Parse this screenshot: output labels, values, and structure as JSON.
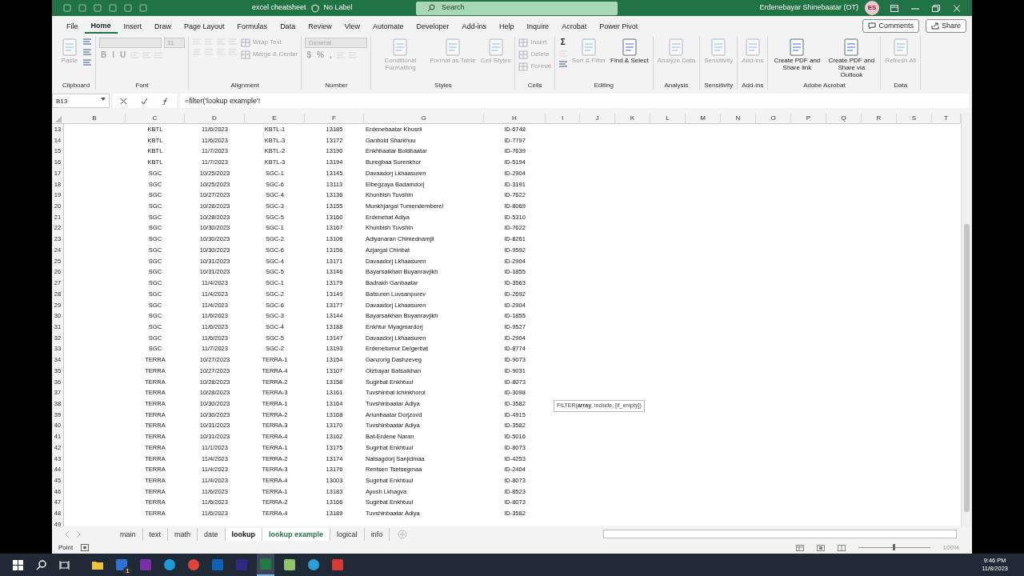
{
  "title_bar": {
    "file_name": "excel cheatsheet",
    "label": "No Label",
    "search_placeholder": "Search",
    "user": "Erdenebayar Shinebaatar (OT)",
    "avatar": "ES"
  },
  "menu_tabs": [
    {
      "label": "File",
      "selected": false
    },
    {
      "label": "Home",
      "selected": true
    },
    {
      "label": "Insert",
      "selected": false
    },
    {
      "label": "Draw",
      "selected": false
    },
    {
      "label": "Page Layout",
      "selected": false
    },
    {
      "label": "Formulas",
      "selected": false
    },
    {
      "label": "Data",
      "selected": false
    },
    {
      "label": "Review",
      "selected": false
    },
    {
      "label": "View",
      "selected": false
    },
    {
      "label": "Automate",
      "selected": false
    },
    {
      "label": "Developer",
      "selected": false
    },
    {
      "label": "Add-ins",
      "selected": false
    },
    {
      "label": "Help",
      "selected": false
    },
    {
      "label": "Inquire",
      "selected": false
    },
    {
      "label": "Acrobat",
      "selected": false
    },
    {
      "label": "Power Pivot",
      "selected": false
    }
  ],
  "comments_button": "Comments",
  "share_button": "Share",
  "ribbon_groups": [
    {
      "label": "Clipboard",
      "items": [
        {
          "kind": "large",
          "label": "Paste",
          "disabled": true
        },
        {
          "kind": "stack",
          "items": [
            {
              "kind": "icon",
              "disabled": false
            },
            {
              "kind": "icon",
              "disabled": false
            },
            {
              "kind": "icon",
              "disabled": false
            }
          ]
        }
      ]
    },
    {
      "label": "Font",
      "items": [
        {
          "kind": "stack",
          "items": [
            {
              "kind": "row",
              "items": [
                {
                  "kind": "field",
                  "disabled": true
                },
                {
                  "kind": "small_field",
                  "value": "11",
                  "disabled": true
                }
              ]
            },
            {
              "kind": "row",
              "items": [
                {
                  "kind": "glyph",
                  "text": "B",
                  "disabled": true
                },
                {
                  "kind": "glyph",
                  "text": "I",
                  "disabled": true
                },
                {
                  "kind": "glyph",
                  "text": "U",
                  "disabled": true
                },
                {
                  "kind": "icon",
                  "disabled": true
                },
                {
                  "kind": "icon",
                  "disabled": true
                },
                {
                  "kind": "icon",
                  "disabled": true
                }
              ]
            }
          ]
        }
      ]
    },
    {
      "label": "Alignment",
      "items": [
        {
          "kind": "stack",
          "items": [
            {
              "kind": "row",
              "items": [
                {
                  "kind": "icon",
                  "disabled": true
                },
                {
                  "kind": "icon",
                  "disabled": true
                },
                {
                  "kind": "icon",
                  "disabled": true
                },
                {
                  "kind": "icon",
                  "disabled": true
                }
              ]
            },
            {
              "kind": "row",
              "items": [
                {
                  "kind": "icon",
                  "disabled": true
                },
                {
                  "kind": "icon",
                  "disabled": true
                },
                {
                  "kind": "icon",
                  "disabled": true
                },
                {
                  "kind": "icon",
                  "disabled": true
                }
              ]
            }
          ]
        },
        {
          "kind": "stack",
          "items": [
            {
              "kind": "small",
              "label": "Wrap Text",
              "disabled": true
            },
            {
              "kind": "small",
              "label": "Merge & Center",
              "disabled": true
            }
          ]
        }
      ]
    },
    {
      "label": "Number",
      "items": [
        {
          "kind": "stack",
          "items": [
            {
              "kind": "field",
              "value": "General",
              "disabled": true
            },
            {
              "kind": "row",
              "items": [
                {
                  "kind": "glyph",
                  "text": "$",
                  "disabled": true
                },
                {
                  "kind": "glyph",
                  "text": "%",
                  "disabled": true
                },
                {
                  "kind": "glyph",
                  "text": ",",
                  "disabled": true
                },
                {
                  "kind": "icon",
                  "disabled": true
                },
                {
                  "kind": "icon",
                  "disabled": true
                }
              ]
            }
          ]
        }
      ]
    },
    {
      "label": "Styles",
      "items": [
        {
          "kind": "large",
          "label": "Conditional Formatting",
          "disabled": true
        },
        {
          "kind": "large",
          "label": "Format as Table",
          "disabled": true
        },
        {
          "kind": "large",
          "label": "Cell Styles",
          "disabled": true
        }
      ]
    },
    {
      "label": "Cells",
      "items": [
        {
          "kind": "stack",
          "items": [
            {
              "kind": "small",
              "label": "Insert",
              "disabled": true
            },
            {
              "kind": "small",
              "label": "Delete",
              "disabled": true
            },
            {
              "kind": "small",
              "label": "Format",
              "disabled": true
            }
          ]
        }
      ]
    },
    {
      "label": "Editing",
      "items": [
        {
          "kind": "stack",
          "items": [
            {
              "kind": "glyph",
              "text": "Σ",
              "disabled": false
            },
            {
              "kind": "icon",
              "disabled": true
            },
            {
              "kind": "icon",
              "disabled": false
            }
          ]
        },
        {
          "kind": "large",
          "label": "Sort & Filter",
          "disabled": true
        },
        {
          "kind": "large",
          "label": "Find & Select",
          "disabled": false
        }
      ]
    },
    {
      "label": "Analysis",
      "items": [
        {
          "kind": "large",
          "label": "Analyze Data",
          "disabled": true
        }
      ]
    },
    {
      "label": "Sensitivity",
      "items": [
        {
          "kind": "large",
          "label": "Sensitivity",
          "disabled": true
        }
      ]
    },
    {
      "label": "Add-ins",
      "items": [
        {
          "kind": "large",
          "label": "Add-ins",
          "disabled": true
        }
      ]
    },
    {
      "label": "Adobe Acrobat",
      "items": [
        {
          "kind": "large",
          "label": "Create PDF and Share link",
          "disabled": false
        },
        {
          "kind": "large",
          "label": "Create PDF and Share via Outlook",
          "disabled": false
        }
      ]
    },
    {
      "label": "Data",
      "items": [
        {
          "kind": "large",
          "label": "Refresh All",
          "disabled": true
        }
      ]
    }
  ],
  "formula_bar": {
    "name_box": "B13",
    "formula": "=filter('lookup example'!"
  },
  "columns": [
    "B",
    "C",
    "D",
    "E",
    "F",
    "G",
    "H",
    "I",
    "J",
    "K",
    "L",
    "M",
    "N",
    "O",
    "P",
    "Q",
    "R",
    "S",
    "T"
  ],
  "rows": [
    {
      "number": "13",
      "values": [
        "KBTL",
        "11/6/2023",
        "KBTL-1",
        "13185",
        "Erdenebaatar Khusrii",
        "ID-6748"
      ]
    },
    {
      "number": "14",
      "values": [
        "KBTL",
        "11/6/2023",
        "KBTL-3",
        "13172",
        "Ganbold Sharkhuu",
        "ID-7797"
      ]
    },
    {
      "number": "15",
      "values": [
        "KBTL",
        "11/7/2023",
        "KBTL-2",
        "13190",
        "Enkhbaatar Boldbaatar",
        "ID-7639"
      ]
    },
    {
      "number": "16",
      "values": [
        "KBTL",
        "11/7/2023",
        "KBTL-3",
        "13194",
        "Buregbaa Surenkhor",
        "ID-5194"
      ]
    },
    {
      "number": "17",
      "values": [
        "SGC",
        "10/25/2023",
        "SGC-1",
        "13145",
        "Davaadorj Lkhaasuren",
        "ID-2904"
      ]
    },
    {
      "number": "18",
      "values": [
        "SGC",
        "10/25/2023",
        "SGC-6",
        "13113",
        "Elbegzaya Badamdorj",
        "ID-3191"
      ]
    },
    {
      "number": "19",
      "values": [
        "SGC",
        "10/27/2023",
        "SGC-4",
        "13136",
        "Khunbish Tuvshin",
        "ID-7622"
      ]
    },
    {
      "number": "20",
      "values": [
        "SGC",
        "10/28/2023",
        "SGC-3",
        "13155",
        "Munkhjargal Tumendemberel",
        "ID-8069"
      ]
    },
    {
      "number": "21",
      "values": [
        "SGC",
        "10/28/2023",
        "SGC-5",
        "13160",
        "Erdenebat Adiya",
        "ID-5310"
      ]
    },
    {
      "number": "22",
      "values": [
        "SGC",
        "10/30/2023",
        "SGC-1",
        "13167",
        "Khunbish Tuvshin",
        "ID-7622"
      ]
    },
    {
      "number": "23",
      "values": [
        "SGC",
        "10/30/2023",
        "SGC-2",
        "13106",
        "Adiyanaran Chimednamjil",
        "ID-8261"
      ]
    },
    {
      "number": "24",
      "values": [
        "SGC",
        "10/30/2023",
        "SGC-6",
        "13156",
        "Azjargal Chinbat",
        "ID-9592"
      ]
    },
    {
      "number": "25",
      "values": [
        "SGC",
        "10/31/2023",
        "SGC-4",
        "13171",
        "Davaadorj Lkhaasuren",
        "ID-2904"
      ]
    },
    {
      "number": "26",
      "values": [
        "SGC",
        "10/31/2023",
        "SGC-5",
        "13146",
        "Bayarsaikhan Buyanravjikh",
        "ID-1855"
      ]
    },
    {
      "number": "27",
      "values": [
        "SGC",
        "11/4/2023",
        "SGC-1",
        "13179",
        "Badrakh Ganbaatar",
        "ID-3563"
      ]
    },
    {
      "number": "28",
      "values": [
        "SGC",
        "11/4/2023",
        "SGC-2",
        "13149",
        "Batsuren Luvsanpurev",
        "ID-2692"
      ]
    },
    {
      "number": "29",
      "values": [
        "SGC",
        "11/4/2023",
        "SGC-6",
        "13177",
        "Davaadorj Lkhaasuren",
        "ID-2904"
      ]
    },
    {
      "number": "30",
      "values": [
        "SGC",
        "11/6/2023",
        "SGC-3",
        "13144",
        "Bayarsaikhan Buyanravjikh",
        "ID-1855"
      ]
    },
    {
      "number": "31",
      "values": [
        "SGC",
        "11/6/2023",
        "SGC-4",
        "13188",
        "Enkhtur Myagmardorj",
        "ID-9527"
      ]
    },
    {
      "number": "32",
      "values": [
        "SGC",
        "11/6/2023",
        "SGC-5",
        "13147",
        "Davaadorj Lkhaasuren",
        "ID-2904"
      ]
    },
    {
      "number": "33",
      "values": [
        "SGC",
        "11/7/2023",
        "SGC-2",
        "13193",
        "Erdenetumur Delgerbat",
        "ID-8774"
      ]
    },
    {
      "number": "34",
      "values": [
        "TERRA",
        "10/27/2023",
        "TERRA-1",
        "13154",
        "Ganzorig Dashzeveg",
        "ID-9073"
      ]
    },
    {
      "number": "35",
      "values": [
        "TERRA",
        "10/27/2023",
        "TERRA-4",
        "13107",
        "Olzbayar Batsaikhan",
        "ID-9031"
      ]
    },
    {
      "number": "36",
      "values": [
        "TERRA",
        "10/28/2023",
        "TERRA-2",
        "13158",
        "Sugirbat Enkhtuul",
        "ID-8073"
      ]
    },
    {
      "number": "37",
      "values": [
        "TERRA",
        "10/28/2023",
        "TERRA-3",
        "13161",
        "Tuvshinbat Ichinkhorol",
        "ID-3098"
      ]
    },
    {
      "number": "38",
      "values": [
        "TERRA",
        "10/30/2023",
        "TERRA-1",
        "13164",
        "Tuvshinbaatar Adiya",
        "ID-3582"
      ]
    },
    {
      "number": "39",
      "values": [
        "TERRA",
        "10/30/2023",
        "TERRA-2",
        "13168",
        "Ariunbaatar Dorjzovd",
        "ID-4915"
      ]
    },
    {
      "number": "40",
      "values": [
        "TERRA",
        "10/31/2023",
        "TERRA-3",
        "13170",
        "Tuvshinbaatar Adiya",
        "ID-3582"
      ]
    },
    {
      "number": "41",
      "values": [
        "TERRA",
        "10/31/2023",
        "TERRA-4",
        "13162",
        "Bat-Erdene Naran",
        "ID-5016"
      ]
    },
    {
      "number": "42",
      "values": [
        "TERRA",
        "11/1/2023",
        "TERRA-1",
        "13175",
        "Sugirbat Enkhtuul",
        "ID-8073"
      ]
    },
    {
      "number": "43",
      "values": [
        "TERRA",
        "11/4/2023",
        "TERRA-2",
        "13174",
        "Natsagdorj Sanjidmaa",
        "ID-4253"
      ]
    },
    {
      "number": "44",
      "values": [
        "TERRA",
        "11/4/2023",
        "TERRA-3",
        "13176",
        "Rentsen Tsetsegmaa",
        "ID-2404"
      ]
    },
    {
      "number": "45",
      "values": [
        "TERRA",
        "11/4/2023",
        "TERRA-4",
        "13003",
        "Sugirbat Enkhtuul",
        "ID-8073"
      ]
    },
    {
      "number": "46",
      "values": [
        "TERRA",
        "11/6/2023",
        "TERRA-1",
        "13183",
        "Ayush Lkhagva",
        "ID-8523"
      ]
    },
    {
      "number": "47",
      "values": [
        "TERRA",
        "11/6/2023",
        "TERRA-2",
        "13166",
        "Sugirbat Enkhtuul",
        "ID-8073"
      ]
    },
    {
      "number": "48",
      "values": [
        "TERRA",
        "11/6/2023",
        "TERRA-4",
        "13189",
        "Tuvshinbaatar Adiya",
        "ID-3582"
      ]
    },
    {
      "number": "49"
    }
  ],
  "function_tooltip": "FILTER(**array**, include, [if_empty])",
  "sheet_tabs": [
    {
      "label": "main",
      "selected": false,
      "referenced": false
    },
    {
      "label": "text",
      "selected": false,
      "referenced": false
    },
    {
      "label": "math",
      "selected": false,
      "referenced": false
    },
    {
      "label": "date",
      "selected": false,
      "referenced": false
    },
    {
      "label": "lookup",
      "selected": true,
      "referenced": false
    },
    {
      "label": "lookup example",
      "selected": false,
      "referenced": true
    },
    {
      "label": "logical",
      "selected": false,
      "referenced": false
    },
    {
      "label": "info",
      "selected": false,
      "referenced": false
    }
  ],
  "status_bar": {
    "mode": "Point",
    "zoom_slider": {
      "level": 0.5
    },
    "zoom": "100%"
  },
  "taskbar": {
    "apps": [
      {
        "kind": "folder",
        "color": "#f0c23b",
        "active": false
      },
      {
        "kind": "check",
        "color": "#2f6fd6",
        "active": false,
        "badge": "1"
      },
      {
        "kind": "notebook",
        "color": "#7b2fa8",
        "active": false
      },
      {
        "kind": "browser",
        "color": "#1f9bd8",
        "active": false
      },
      {
        "kind": "chrome",
        "color": "#e0453a",
        "active": false
      },
      {
        "kind": "mail",
        "color": "#0f64b8",
        "active": false
      },
      {
        "kind": "app",
        "color": "#2c2a86",
        "active": false
      },
      {
        "kind": "spreadsheet",
        "color": "#1f7a45",
        "active": true
      },
      {
        "kind": "photo",
        "color": "#8fc46a",
        "active": false
      },
      {
        "kind": "plane",
        "color": "#2a9fd9",
        "active": false
      },
      {
        "kind": "app",
        "color": "#d83a33",
        "active": false
      }
    ],
    "time": "9:46 PM",
    "date": "11/8/2023"
  }
}
